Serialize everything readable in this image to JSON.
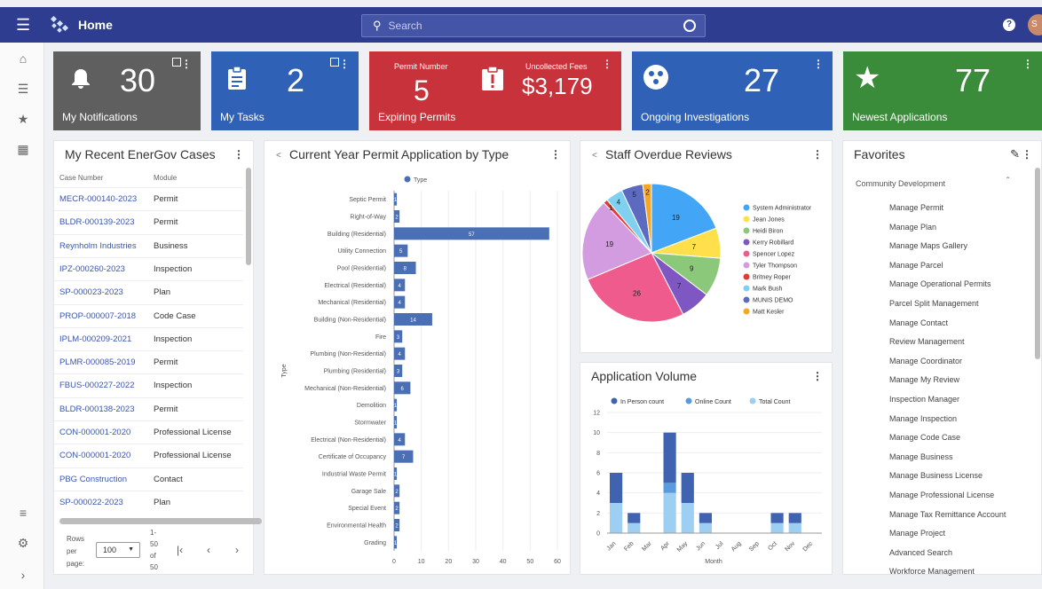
{
  "topbar": {
    "title": "Home",
    "search_placeholder": "Search",
    "avatar": "S"
  },
  "tiles": [
    {
      "label": "My Notifications",
      "value": "30",
      "bg": "#5f5f5f"
    },
    {
      "label": "My Tasks",
      "value": "2",
      "bg": "#2f62b7"
    },
    {
      "label": "Expiring Permits",
      "value": "5",
      "caption1": "Permit Number",
      "caption2": "Uncollected Fees",
      "value2": "$3,179",
      "bg": "#c8323a"
    },
    {
      "label": "Ongoing Investigations",
      "value": "27",
      "bg": "#2f62b7"
    },
    {
      "label": "Newest Applications",
      "value": "77",
      "bg": "#3a8b3a"
    }
  ],
  "cases": {
    "title": "My Recent EnerGov Cases",
    "col1": "Case Number",
    "col2": "Module",
    "rows": [
      {
        "case": "MECR-000140-2023",
        "module": "Permit"
      },
      {
        "case": "BLDR-000139-2023",
        "module": "Permit"
      },
      {
        "case": "Reynholm Industries",
        "module": "Business"
      },
      {
        "case": "IPZ-000260-2023",
        "module": "Inspection"
      },
      {
        "case": "SP-000023-2023",
        "module": "Plan"
      },
      {
        "case": "PROP-000007-2018",
        "module": "Code Case"
      },
      {
        "case": "IPLM-000209-2021",
        "module": "Inspection"
      },
      {
        "case": "PLMR-000085-2019",
        "module": "Permit"
      },
      {
        "case": "FBUS-000227-2022",
        "module": "Inspection"
      },
      {
        "case": "BLDR-000138-2023",
        "module": "Permit"
      },
      {
        "case": "CON-000001-2020",
        "module": "Professional License"
      },
      {
        "case": "CON-000001-2020",
        "module": "Professional License"
      },
      {
        "case": "PBG Construction",
        "module": "Contact"
      },
      {
        "case": "SP-000022-2023",
        "module": "Plan"
      }
    ],
    "pager": {
      "rows_label1": "Rows",
      "rows_label2": "per",
      "rows_label3": "page:",
      "rows_value": "100",
      "range1": "1-",
      "range2": "50",
      "range3": "of",
      "range4": "50"
    }
  },
  "permit_chart": {
    "title": "Current Year Permit Application by Type",
    "legend": "Type",
    "ylabel": "Type"
  },
  "pie_chart": {
    "title": "Staff Overdue Reviews"
  },
  "volume_chart": {
    "title": "Application Volume",
    "xlabel": "Month"
  },
  "favorites": {
    "title": "Favorites",
    "group": "Community Development",
    "items": [
      "Manage Permit",
      "Manage Plan",
      "Manage Maps Gallery",
      "Manage Parcel",
      "Manage Operational Permits",
      "Parcel Split Management",
      "Manage Contact",
      "Review Management",
      "Manage Coordinator",
      "Manage My Review",
      "Inspection Manager",
      "Manage Inspection",
      "Manage Code Case",
      "Manage Business",
      "Manage Business License",
      "Manage Professional License",
      "Manage Tax Remittance Account",
      "Manage Project",
      "Advanced Search",
      "Workforce Management"
    ]
  },
  "chart_data": [
    {
      "type": "bar",
      "orientation": "horizontal",
      "title": "Current Year Permit Application by Type",
      "ylabel": "Type",
      "legend": [
        "Type"
      ],
      "categories": [
        "Septic Permit",
        "Right-of-Way",
        "Building (Residential)",
        "Utility Connection",
        "Pool (Residential)",
        "Electrical (Residential)",
        "Mechanical (Residential)",
        "Building (Non-Residential)",
        "Fire",
        "Plumbing (Non-Residential)",
        "Plumbing (Residential)",
        "Mechanical (Non-Residential)",
        "Demolition",
        "Stormwater",
        "Electrical (Non-Residential)",
        "Certificate of Occupancy",
        "Industrial Waste Permit",
        "Garage Sale",
        "Special Event",
        "Environmental Health",
        "Grading"
      ],
      "values": [
        1,
        2,
        57,
        5,
        8,
        4,
        4,
        14,
        3,
        4,
        3,
        6,
        1,
        1,
        4,
        7,
        1,
        2,
        2,
        2,
        1
      ],
      "xlim": [
        0,
        60
      ],
      "xticks": [
        0,
        10,
        20,
        30,
        40,
        50,
        60
      ],
      "color": "#4a6fb5"
    },
    {
      "type": "pie",
      "title": "Staff Overdue Reviews",
      "legend_position": "right",
      "slices": [
        {
          "name": "System Administrator",
          "value": 19,
          "color": "#42a5f5"
        },
        {
          "name": "Jean Jones",
          "value": 7,
          "color": "#ffe04a"
        },
        {
          "name": "Heidi Biron",
          "value": 9,
          "color": "#8bc87a"
        },
        {
          "name": "Kerry Robillard",
          "value": 7,
          "color": "#7e57c2"
        },
        {
          "name": "Spencer Lopez",
          "value": 26,
          "color": "#ef5b8c"
        },
        {
          "name": "Tyler Thompson",
          "value": 19,
          "color": "#d39ce0"
        },
        {
          "name": "Britney Roper",
          "value": 1,
          "color": "#e53935"
        },
        {
          "name": "Mark Bush",
          "value": 4,
          "color": "#80d0f0"
        },
        {
          "name": "MUNIS DEMO",
          "value": 5,
          "color": "#5c6bc0"
        },
        {
          "name": "Matt Kesler",
          "value": 2,
          "color": "#f5a623"
        }
      ]
    },
    {
      "type": "bar",
      "stacked": true,
      "title": "Application Volume",
      "xlabel": "Month",
      "categories": [
        "Jan",
        "Feb",
        "Mar",
        "Apr",
        "May",
        "Jun",
        "Jul",
        "Aug",
        "Sep",
        "Oct",
        "Nov",
        "Dec"
      ],
      "series": [
        {
          "name": "In Person count",
          "values": [
            3,
            1,
            0,
            5,
            3,
            1,
            0,
            0,
            0,
            1,
            1,
            0
          ],
          "color": "#3f63b0"
        },
        {
          "name": "Online Count",
          "values": [
            0,
            0,
            0,
            1,
            0,
            0,
            0,
            0,
            0,
            0,
            0,
            0
          ],
          "color": "#5a9be0"
        },
        {
          "name": "Total Count",
          "values": [
            3,
            1,
            0,
            4,
            3,
            1,
            0,
            0,
            0,
            1,
            1,
            0
          ],
          "color": "#9ccff2"
        }
      ],
      "ylim": [
        0,
        12
      ],
      "yticks": [
        0,
        2,
        4,
        6,
        8,
        10,
        12
      ]
    }
  ]
}
